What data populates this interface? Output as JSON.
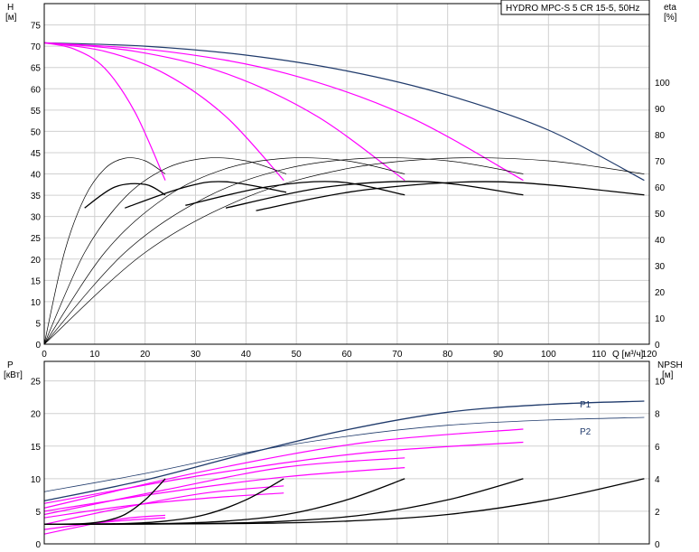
{
  "chart_data": [
    {
      "type": "line",
      "title": "HYDRO MPC-S 5 CR 15-5, 50Hz",
      "xlabel": "Q [м³/ч]",
      "ylabel_left": "H",
      "ylabel_left_unit": "[м]",
      "ylabel_right": "eta",
      "ylabel_right_unit": "[%]",
      "xlim": [
        0,
        120
      ],
      "ylim_left": [
        0,
        80
      ],
      "ylim_right": [
        0,
        130
      ],
      "x_ticks": [
        0,
        10,
        20,
        30,
        40,
        50,
        60,
        70,
        80,
        90,
        100,
        110,
        120
      ],
      "y_left_ticks": [
        0,
        5,
        10,
        15,
        20,
        25,
        30,
        35,
        40,
        45,
        50,
        55,
        60,
        65,
        70,
        75
      ],
      "y_right_ticks": [
        0,
        10,
        20,
        30,
        40,
        50,
        60,
        70,
        80,
        90,
        100
      ],
      "grid": true,
      "colors": {
        "system": "#1f3a6b",
        "pump": "#ff00ff",
        "efficiency": "#000000"
      },
      "series": [
        {
          "role": "head-system",
          "axis": "left",
          "color": "#1f3a6b",
          "x": [
            0,
            20,
            40,
            60,
            80,
            100,
            119
          ],
          "y": [
            70.8,
            70.0,
            67.9,
            64.2,
            58.5,
            50.3,
            38.5
          ]
        },
        {
          "role": "head-pump",
          "axis": "left",
          "color": "#ff00ff",
          "x": [
            0,
            6,
            12,
            18,
            24
          ],
          "y": [
            70.8,
            69.3,
            64.8,
            54.5,
            38.5
          ]
        },
        {
          "role": "head-pump",
          "axis": "left",
          "color": "#ff00ff",
          "x": [
            0,
            12,
            24,
            36,
            47.5
          ],
          "y": [
            70.8,
            68.8,
            63.5,
            53.5,
            38.5
          ]
        },
        {
          "role": "head-pump",
          "axis": "left",
          "color": "#ff00ff",
          "x": [
            0,
            18,
            36,
            54,
            71.5
          ],
          "y": [
            70.8,
            68.8,
            63.6,
            53.6,
            38.5
          ]
        },
        {
          "role": "head-pump",
          "axis": "left",
          "color": "#ff00ff",
          "x": [
            0,
            24,
            48,
            72,
            95
          ],
          "y": [
            70.8,
            68.8,
            63.6,
            53.6,
            38.5
          ]
        },
        {
          "role": "eta",
          "axis": "right",
          "color": "#000000",
          "width": 0.7,
          "x": [
            0,
            4,
            8,
            12,
            16,
            20,
            24
          ],
          "y": [
            0,
            35,
            56,
            67,
            71,
            70,
            65
          ]
        },
        {
          "role": "eta",
          "axis": "right",
          "color": "#000000",
          "width": 0.7,
          "x": [
            0,
            8,
            16,
            24,
            32,
            40,
            48
          ],
          "y": [
            0,
            35,
            56,
            67,
            71,
            70,
            65
          ]
        },
        {
          "role": "eta",
          "axis": "right",
          "color": "#000000",
          "width": 0.7,
          "x": [
            0,
            12,
            24,
            36,
            48,
            60,
            71.5
          ],
          "y": [
            0,
            35,
            56,
            67,
            71,
            70,
            65
          ]
        },
        {
          "role": "eta",
          "axis": "right",
          "color": "#000000",
          "width": 0.7,
          "x": [
            0,
            16,
            32,
            48,
            64,
            80,
            95
          ],
          "y": [
            0,
            35,
            56,
            67,
            71,
            70,
            65
          ]
        },
        {
          "role": "eta",
          "axis": "right",
          "color": "#000000",
          "width": 0.7,
          "x": [
            0,
            20,
            40,
            60,
            80,
            100,
            119
          ],
          "y": [
            0,
            35,
            56,
            67,
            71,
            70,
            65
          ]
        },
        {
          "role": "eta-system",
          "axis": "right",
          "color": "#000000",
          "width": 1.3,
          "x": [
            8,
            14,
            20,
            24
          ],
          "y": [
            52,
            60,
            61,
            57
          ]
        },
        {
          "role": "eta-system",
          "axis": "right",
          "color": "#000000",
          "width": 1.3,
          "x": [
            16,
            28,
            36,
            48
          ],
          "y": [
            52,
            60,
            62,
            58
          ]
        },
        {
          "role": "eta-system",
          "axis": "right",
          "color": "#000000",
          "width": 1.3,
          "x": [
            28,
            44,
            58,
            71.5
          ],
          "y": [
            53,
            60,
            62,
            57
          ]
        },
        {
          "role": "eta-system",
          "axis": "right",
          "color": "#000000",
          "width": 1.3,
          "x": [
            36,
            56,
            76,
            95
          ],
          "y": [
            52,
            60,
            62,
            57
          ]
        },
        {
          "role": "eta-system",
          "axis": "right",
          "color": "#000000",
          "width": 1.3,
          "x": [
            42,
            64,
            90,
            119
          ],
          "y": [
            51,
            59,
            62,
            57
          ]
        }
      ]
    },
    {
      "type": "line",
      "xlabel": "",
      "ylabel_left": "P",
      "ylabel_left_unit": "[кВт]",
      "ylabel_right": "NPSH",
      "ylabel_right_unit": "[м]",
      "xlim": [
        0,
        120
      ],
      "ylim_left": [
        0,
        28
      ],
      "ylim_right": [
        0,
        11.2
      ],
      "y_left_ticks": [
        0,
        5,
        10,
        15,
        20,
        25
      ],
      "y_right_ticks": [
        0,
        2,
        4,
        6,
        8,
        10
      ],
      "grid": true,
      "colors": {
        "p1": "#1f3a6b",
        "p2": "#1f3a6b",
        "pump": "#ff00ff",
        "npsh": "#000000"
      },
      "series": [
        {
          "name": "P1",
          "axis": "left",
          "color": "#1f3a6b",
          "width": 1.3,
          "x": [
            0,
            20,
            40,
            60,
            80,
            100,
            119
          ],
          "y": [
            6.6,
            9.8,
            13.8,
            17.5,
            20.2,
            21.4,
            21.9
          ]
        },
        {
          "name": "P2",
          "axis": "left",
          "color": "#1f3a6b",
          "width": 0.8,
          "x": [
            0,
            20,
            40,
            60,
            80,
            100,
            119
          ],
          "y": [
            8.0,
            10.8,
            14.0,
            16.5,
            18.2,
            19.0,
            19.4
          ]
        },
        {
          "role": "pump-power",
          "axis": "left",
          "color": "#ff00ff",
          "x": [
            0,
            8,
            16,
            24
          ],
          "y": [
            1.5,
            2.8,
            3.9,
            4.4
          ]
        },
        {
          "role": "pump-power",
          "axis": "left",
          "color": "#ff00ff",
          "x": [
            0,
            8,
            16,
            24
          ],
          "y": [
            2.2,
            3.0,
            3.6,
            4.0
          ]
        },
        {
          "role": "pump-power",
          "axis": "left",
          "color": "#ff00ff",
          "x": [
            0,
            16,
            32,
            47.5
          ],
          "y": [
            3.0,
            5.6,
            7.8,
            8.9
          ]
        },
        {
          "role": "pump-power",
          "axis": "left",
          "color": "#ff00ff",
          "x": [
            0,
            16,
            32,
            47.5
          ],
          "y": [
            4.0,
            5.8,
            7.0,
            7.8
          ]
        },
        {
          "role": "pump-power",
          "axis": "left",
          "color": "#ff00ff",
          "x": [
            0,
            24,
            48,
            71.5
          ],
          "y": [
            4.5,
            8.3,
            11.8,
            13.2
          ]
        },
        {
          "role": "pump-power",
          "axis": "left",
          "color": "#ff00ff",
          "x": [
            0,
            24,
            48,
            71.5
          ],
          "y": [
            5.0,
            7.9,
            10.3,
            11.7
          ]
        },
        {
          "role": "pump-power",
          "axis": "left",
          "color": "#ff00ff",
          "x": [
            0,
            32,
            64,
            95
          ],
          "y": [
            5.5,
            11.2,
            15.6,
            17.6
          ]
        },
        {
          "role": "pump-power",
          "axis": "left",
          "color": "#ff00ff",
          "x": [
            0,
            32,
            64,
            95
          ],
          "y": [
            6.2,
            10.6,
            14.0,
            15.6
          ]
        },
        {
          "role": "npsh",
          "axis": "right",
          "color": "#000000",
          "width": 1.3,
          "x": [
            0,
            8,
            12,
            16,
            20,
            24
          ],
          "y": [
            1.2,
            1.25,
            1.4,
            1.8,
            2.7,
            4.0
          ]
        },
        {
          "role": "npsh",
          "axis": "right",
          "color": "#000000",
          "width": 1.3,
          "x": [
            0,
            16,
            24,
            32,
            40,
            47.5
          ],
          "y": [
            1.2,
            1.25,
            1.4,
            1.8,
            2.7,
            4.0
          ]
        },
        {
          "role": "npsh",
          "axis": "right",
          "color": "#000000",
          "width": 1.3,
          "x": [
            0,
            24,
            36,
            48,
            60,
            71.5
          ],
          "y": [
            1.2,
            1.25,
            1.4,
            1.8,
            2.7,
            4.0
          ]
        },
        {
          "role": "npsh",
          "axis": "right",
          "color": "#000000",
          "width": 1.3,
          "x": [
            0,
            32,
            48,
            64,
            80,
            95
          ],
          "y": [
            1.2,
            1.25,
            1.4,
            1.8,
            2.7,
            4.0
          ]
        },
        {
          "role": "npsh",
          "axis": "right",
          "color": "#000000",
          "width": 1.3,
          "x": [
            0,
            40,
            60,
            80,
            100,
            119
          ],
          "y": [
            1.2,
            1.25,
            1.4,
            1.8,
            2.7,
            4.0
          ]
        }
      ]
    }
  ]
}
